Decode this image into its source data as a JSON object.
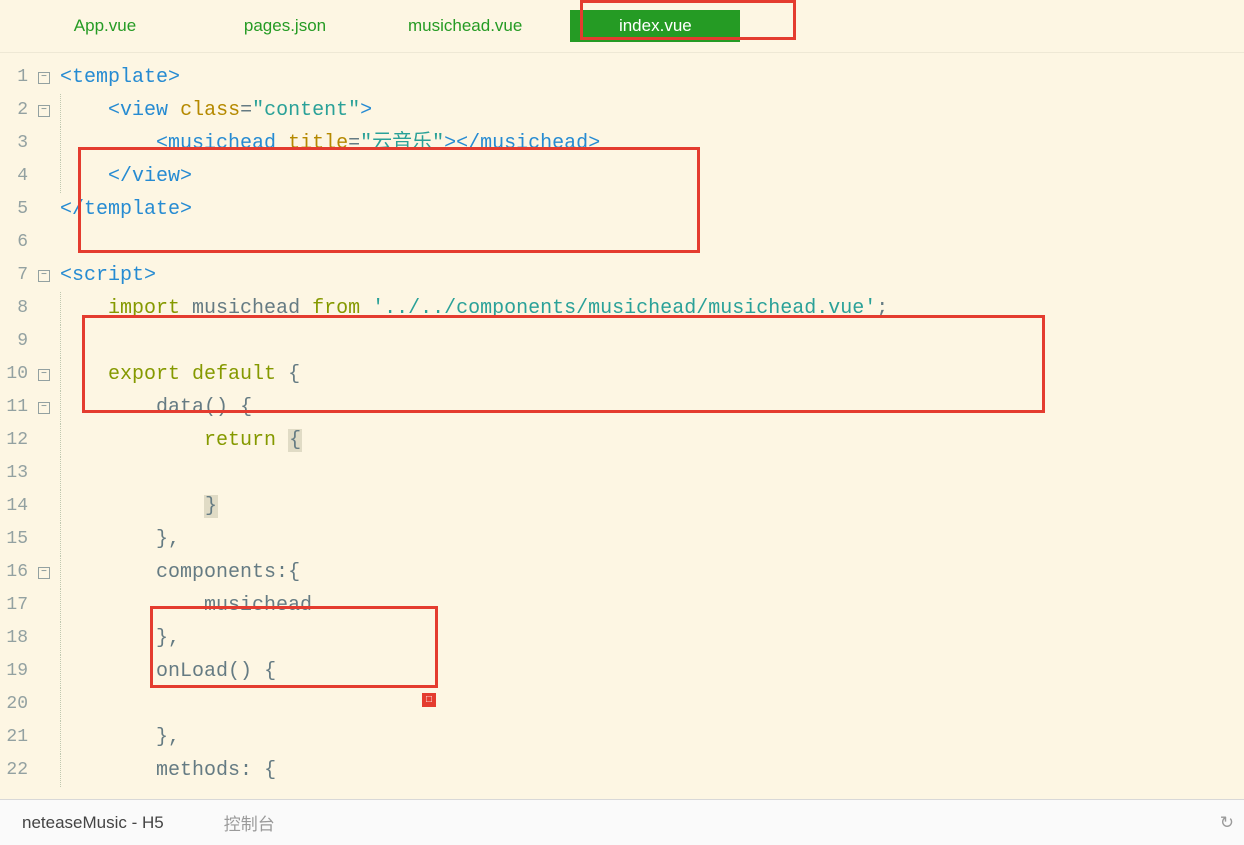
{
  "tabs": [
    "App.vue",
    "pages.json",
    "musichead.vue",
    "index.vue"
  ],
  "activeTab": "index.vue",
  "status": {
    "project": "neteaseMusic - H5",
    "console": "控制台"
  },
  "foldGlyph": "−",
  "annDot": "□",
  "code": {
    "l1": {
      "open": "<",
      "tag": "template",
      "close": ">"
    },
    "l2": {
      "ind": "    ",
      "open": "<",
      "tag": "view",
      "sp": " ",
      "attr": "class",
      "eq": "=",
      "q1": "\"",
      "val": "content",
      "q2": "\"",
      "close": ">"
    },
    "l3": {
      "ind": "        ",
      "open": "<",
      "tag": "musichead",
      "sp": " ",
      "attr": "title",
      "eq": "=",
      "q1": "\"",
      "val": "云音乐",
      "q2": "\"",
      "mid": "></",
      "tag2": "musichead",
      "close2": ">"
    },
    "l4": {
      "ind": "    ",
      "open": "</",
      "tag": "view",
      "close": ">"
    },
    "l5": {
      "open": "</",
      "tag": "template",
      "close": ">"
    },
    "l6": "",
    "l7": {
      "open": "<",
      "tag": "script",
      "close": ">"
    },
    "l8": {
      "ind": "    ",
      "kw1": "import",
      "sp1": " ",
      "name": "musichead",
      "sp2": " ",
      "kw2": "from",
      "sp3": " ",
      "q1": "'",
      "path": "../../components/musichead/musichead.vue",
      "q2": "'",
      "semi": ";"
    },
    "l9": "",
    "l10": {
      "ind": "    ",
      "kw1": "export",
      "sp1": " ",
      "kw2": "default",
      "sp2": " ",
      "brace": "{"
    },
    "l11": {
      "ind": "        ",
      "name": "data",
      "paren": "()",
      "sp": " ",
      "brace": "{"
    },
    "l12": {
      "ind": "            ",
      "kw": "return",
      "sp": " ",
      "brace": "{"
    },
    "l13": {
      "ind": "                "
    },
    "l14": {
      "ind": "            ",
      "brace": "}"
    },
    "l15": {
      "ind": "        ",
      "brace": "}",
      "comma": ","
    },
    "l16": {
      "ind": "        ",
      "name": "components",
      "colon": ":",
      "brace": "{"
    },
    "l17": {
      "ind": "            ",
      "name": "musichead"
    },
    "l18": {
      "ind": "        ",
      "brace": "}",
      "comma": ","
    },
    "l19": {
      "ind": "        ",
      "name": "onLoad",
      "paren": "()",
      "sp": " ",
      "brace": "{"
    },
    "l20": "",
    "l21": {
      "ind": "        ",
      "brace": "}",
      "comma": ","
    },
    "l22": {
      "ind": "        ",
      "name": "methods",
      "colon": ":",
      "sp": " ",
      "brace": "{"
    }
  }
}
